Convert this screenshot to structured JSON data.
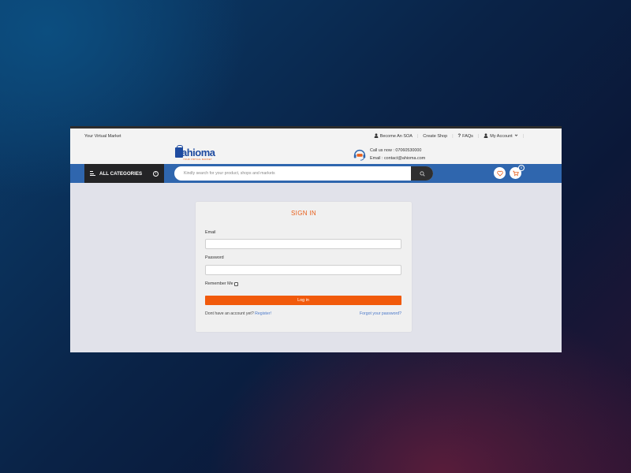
{
  "topbar": {
    "tagline": "Your Virtual Market",
    "links": {
      "become_soa": "Become An SOA",
      "create_shop": "Create Shop",
      "faqs": "FAQs",
      "my_account": "My Account"
    }
  },
  "header": {
    "logo_text": "ahioma",
    "logo_subtitle": "YOUR VIRTUAL MARKET",
    "call_line": "Call us now : 07060530000",
    "email_line": "Email : contact@ahioma.com"
  },
  "nav": {
    "all_categories": "ALL CATEGORIES",
    "search_placeholder": "Kindly search for your product, shops and markets",
    "cart_count": "0"
  },
  "signin": {
    "title": "SIGN IN",
    "email_label": "Email",
    "email_value": "",
    "password_label": "Password",
    "password_value": "",
    "remember_label": "Remember Me",
    "remember_checked": false,
    "login_button": "Log in",
    "no_account_text": "Dont have an account yet?",
    "register_link": "Register!",
    "forgot_link": "Forgot your password?"
  },
  "colors": {
    "accent": "#f15a0c",
    "nav_blue": "#2f66ae",
    "dark": "#242426"
  },
  "icons": [
    "user-icon",
    "question-icon",
    "chevron-down-icon",
    "headset-icon",
    "menu-icon",
    "circle-arrow-icon",
    "search-icon",
    "heart-icon",
    "cart-icon"
  ]
}
